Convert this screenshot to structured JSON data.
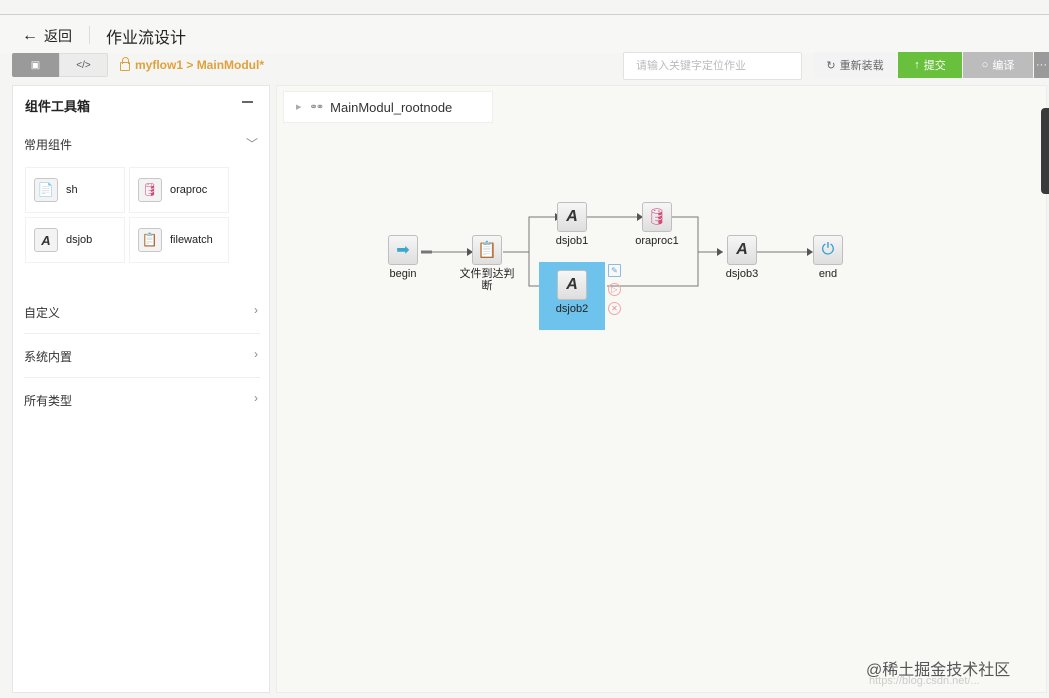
{
  "header": {
    "back_label": "返回",
    "title": "作业流设计"
  },
  "toolbar": {
    "view_modes": [
      "design-icon",
      "code-icon"
    ],
    "code_glyph": "</>",
    "path": "myflow1 > MainModul*",
    "search_placeholder": "请输入关键字定位作业",
    "reload_label": "重新装载",
    "submit_label": "提交",
    "compile_label": "编译",
    "more_label": "···"
  },
  "toolbox": {
    "title": "组件工具箱",
    "sections": [
      {
        "label": "常用组件",
        "expanded": true
      },
      {
        "label": "自定义",
        "expanded": false
      },
      {
        "label": "系统内置",
        "expanded": false
      },
      {
        "label": "所有类型",
        "expanded": false
      }
    ],
    "components": [
      {
        "label": "sh",
        "icon": "sh-icon"
      },
      {
        "label": "oraproc",
        "icon": "database-icon"
      },
      {
        "label": "dsjob",
        "icon": "dsjob-icon"
      },
      {
        "label": "filewatch",
        "icon": "filewatch-icon"
      }
    ]
  },
  "canvas": {
    "root_label": "MainModul_rootnode",
    "nodes": [
      {
        "id": "begin",
        "label": "begin",
        "icon": "arrow-right-icon"
      },
      {
        "id": "filecheck",
        "label": "文件到达判断",
        "icon": "filewatch-icon"
      },
      {
        "id": "dsjob1",
        "label": "dsjob1",
        "icon": "dsjob-icon"
      },
      {
        "id": "oraproc1",
        "label": "oraproc1",
        "icon": "database-icon"
      },
      {
        "id": "dsjob2",
        "label": "dsjob2",
        "icon": "dsjob-icon",
        "selected": true
      },
      {
        "id": "dsjob3",
        "label": "dsjob3",
        "icon": "dsjob-icon"
      },
      {
        "id": "end",
        "label": "end",
        "icon": "power-icon"
      }
    ]
  },
  "watermark": {
    "text": "@稀土掘金技术社区",
    "url": "https://blog.csdn.net/..."
  },
  "colors": {
    "accent_orange": "#e0a13c",
    "submit_green": "#69c03c",
    "selected_blue": "#6ec3ec"
  }
}
